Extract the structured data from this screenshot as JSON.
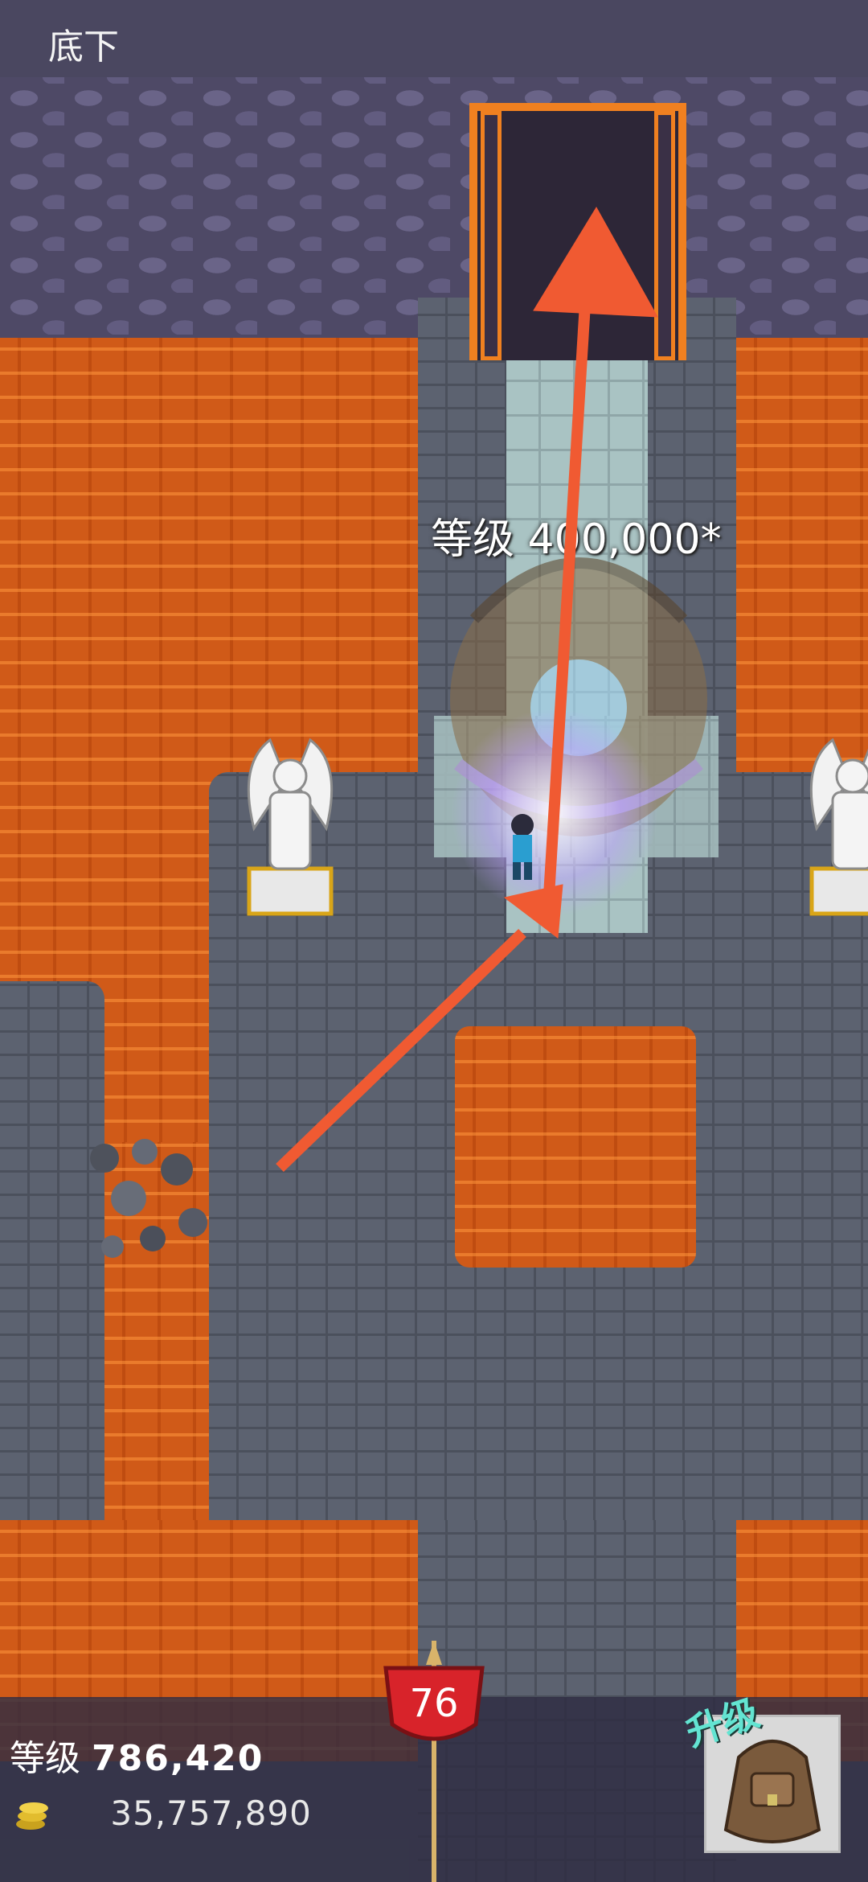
{
  "header": {
    "title": "底下"
  },
  "boss": {
    "level_label": "等级 400,000*"
  },
  "player": {
    "level_prefix": "等级",
    "level_value": "786,420",
    "gold_value": "35,757,890",
    "gold_icon": "gold-coins-icon"
  },
  "floor_badge": {
    "value": "76"
  },
  "upgrade": {
    "label": "升级",
    "icon": "backpack-icon"
  },
  "colors": {
    "lava": "#d05a18",
    "stone": "#5c6270",
    "wall": "#4e4966",
    "door_frame": "#f08020",
    "annotation_arrow": "#f05a32",
    "badge_red": "#d8232a",
    "upgrade_teal": "#63e4d2"
  }
}
